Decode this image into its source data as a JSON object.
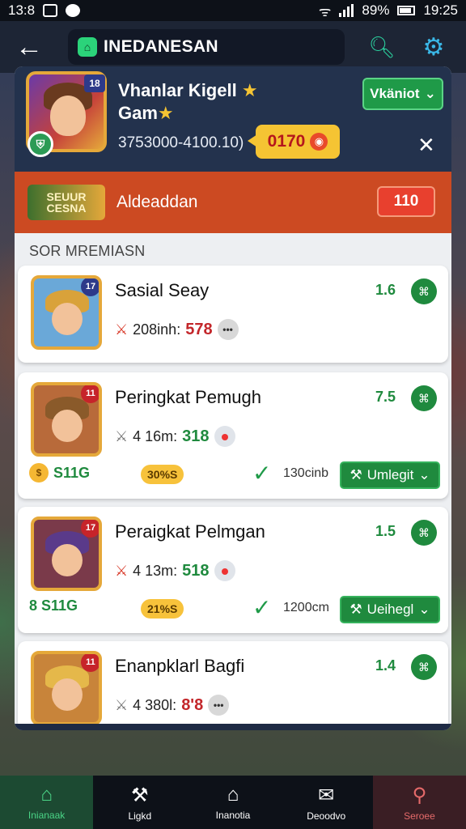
{
  "status_bar": {
    "time_left": "13:8",
    "battery": "89%",
    "time_right": "19:25"
  },
  "app_bar": {
    "title": "INEDANESAN"
  },
  "profile": {
    "name_line1": "Vhanlar Kigell",
    "name_line2": "Gam",
    "stats": "3753000-4100.10)",
    "action_button": "Vkäniot",
    "coin_value": "0170",
    "level_badge": "18"
  },
  "banner": {
    "logo_text": "SEUUR CESNA",
    "title": "Aldeaddan",
    "badge": "110"
  },
  "section_header": "SOR MREMIASN",
  "cards": [
    {
      "title": "Sasial Seay",
      "score": "1.6",
      "meta_label": "208inh:",
      "meta_value": "578",
      "thumb_tag": "17",
      "hair": "#d9a23a",
      "bg": "#6aa8d8"
    },
    {
      "title": "Peringkat Pemugh",
      "score": "7.5",
      "meta_label": "4 16m:",
      "meta_value": "318",
      "thumb_tag": "11",
      "hair": "#8a5a2a",
      "bg": "#b86a3a",
      "coin_level": "S11G",
      "gold_pill": "30%S",
      "duration": "130cinb",
      "upgrade_label": "Umlegit"
    },
    {
      "title": "Peraigkat Pelmgan",
      "score": "1.5",
      "meta_label": "4 13m:",
      "meta_value": "518",
      "thumb_tag": "17",
      "hair": "#5a3a8a",
      "bg": "#7a3a4a",
      "coin_level": "8 S11G",
      "gold_pill": "21%S",
      "duration": "1200cm",
      "upgrade_label": "Ueihegl"
    },
    {
      "title": "Enanpklarl Bagfi",
      "score": "1.4",
      "meta_label": "4 380l:",
      "meta_value": "8'8",
      "thumb_tag": "11",
      "hair": "#e5b84a",
      "bg": "#c8843a"
    }
  ],
  "bottom_nav": [
    {
      "label": "Inianaak"
    },
    {
      "label": "Ligkd"
    },
    {
      "label": "Inanotia"
    },
    {
      "label": "Deoodvo"
    },
    {
      "label": "Seroee"
    }
  ],
  "colors": {
    "accent_green": "#1f8a3e",
    "banner_orange": "#cc4a22",
    "profile_navy": "#23324d",
    "coin_yellow": "#f5c433"
  }
}
